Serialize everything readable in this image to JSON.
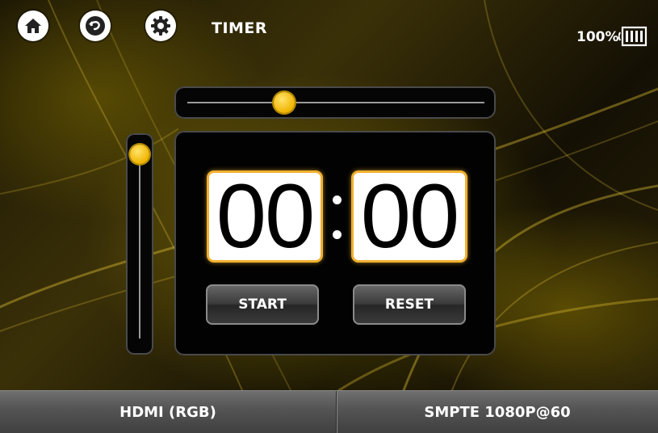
{
  "header": {
    "title": "TIMER",
    "battery_percent": "100%",
    "battery_level": 1.0,
    "icons": [
      "home-icon",
      "back-icon",
      "gear-icon",
      "battery-icon"
    ]
  },
  "sliders": {
    "horizontal_value": 0.32,
    "vertical_value": 1.0
  },
  "timer": {
    "minutes": "00",
    "seconds": "00",
    "start_label": "START",
    "reset_label": "RESET"
  },
  "bottom_bar": {
    "input_source": "HDMI (RGB)",
    "video_format": "SMPTE 1080P@60"
  },
  "colors": {
    "accent": "#f0b400",
    "panel": "#020202",
    "text": "#ffffff"
  }
}
